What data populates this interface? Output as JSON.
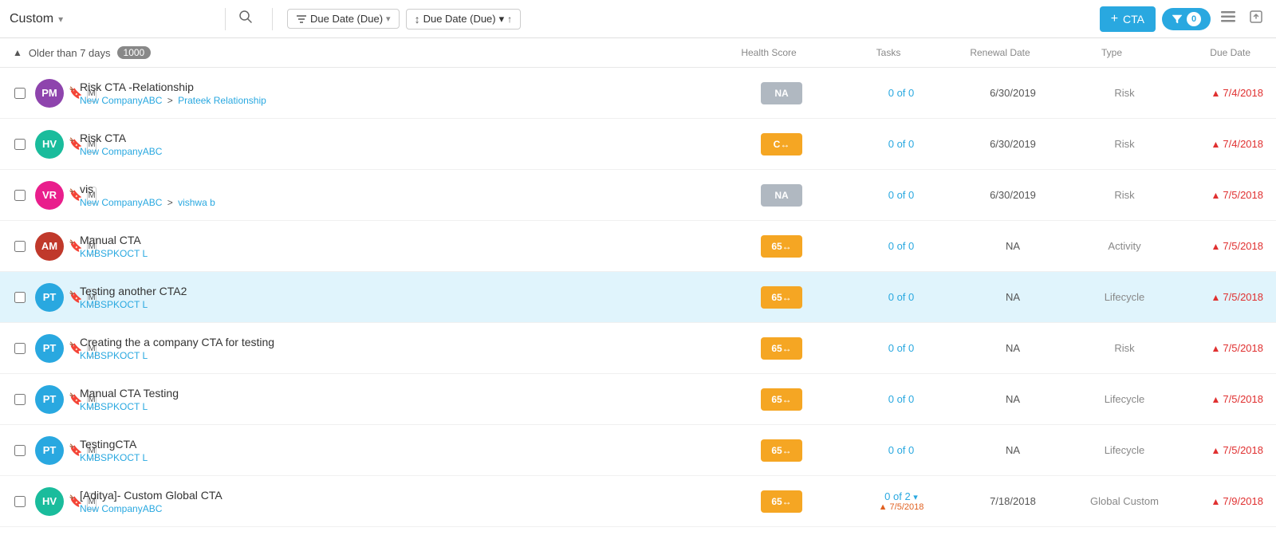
{
  "topbar": {
    "dropdown_label": "Custom",
    "filter1_label": "Due Date (Due)",
    "filter2_label": "Due Date (Due)",
    "cta_button": "+ CTA",
    "filter_count": "0",
    "icons": [
      "search",
      "filter",
      "export",
      "expand"
    ]
  },
  "group": {
    "label": "Older than 7 days",
    "count": "1000"
  },
  "columns": {
    "health": "Health Score",
    "tasks": "Tasks",
    "renewal": "Renewal Date",
    "type": "Type",
    "due": "Due Date"
  },
  "rows": [
    {
      "id": 1,
      "initials": "PM",
      "avatar_color": "#8e44ad",
      "title": "Risk CTA -Relationship",
      "company": "New CompanyABC",
      "sub": "Prateek Relationship",
      "has_sub": true,
      "health": "NA",
      "health_type": "na",
      "tasks": "0 of 0",
      "tasks_link": true,
      "renewal": "6/30/2019",
      "type": "Risk",
      "due": "7/4/2018",
      "due_overdue": true,
      "highlighted": false
    },
    {
      "id": 2,
      "initials": "HV",
      "avatar_color": "#1abc9c",
      "title": "Risk CTA",
      "company": "New CompanyABC",
      "sub": "",
      "has_sub": false,
      "health": "C↔",
      "health_type": "orange",
      "tasks": "0 of 0",
      "tasks_link": true,
      "renewal": "6/30/2019",
      "type": "Risk",
      "due": "7/4/2018",
      "due_overdue": true,
      "highlighted": false
    },
    {
      "id": 3,
      "initials": "VR",
      "avatar_color": "#e91e8c",
      "title": "vis",
      "company": "New CompanyABC",
      "sub": "vishwa b",
      "has_sub": true,
      "health": "NA",
      "health_type": "na",
      "tasks": "0 of 0",
      "tasks_link": true,
      "renewal": "6/30/2019",
      "type": "Risk",
      "due": "7/5/2018",
      "due_overdue": true,
      "highlighted": false
    },
    {
      "id": 4,
      "initials": "AM",
      "avatar_color": "#c0392b",
      "title": "Manual CTA",
      "company": "KMBSPKOCT L",
      "sub": "",
      "has_sub": false,
      "health": "65↔",
      "health_type": "orange",
      "tasks": "0 of 0",
      "tasks_link": true,
      "renewal": "NA",
      "type": "Activity",
      "due": "7/5/2018",
      "due_overdue": true,
      "highlighted": false
    },
    {
      "id": 5,
      "initials": "PT",
      "avatar_color": "#29a8e0",
      "title": "Testing another CTA2",
      "company": "KMBSPKOCT L",
      "sub": "",
      "has_sub": false,
      "health": "65↔",
      "health_type": "orange",
      "tasks": "0 of 0",
      "tasks_link": true,
      "renewal": "NA",
      "type": "Lifecycle",
      "due": "7/5/2018",
      "due_overdue": true,
      "highlighted": true
    },
    {
      "id": 6,
      "initials": "PT",
      "avatar_color": "#29a8e0",
      "title": "Creating the a company CTA for testing",
      "company": "KMBSPKOCT L",
      "sub": "",
      "has_sub": false,
      "health": "65↔",
      "health_type": "orange",
      "tasks": "0 of 0",
      "tasks_link": true,
      "renewal": "NA",
      "type": "Risk",
      "due": "7/5/2018",
      "due_overdue": true,
      "highlighted": false
    },
    {
      "id": 7,
      "initials": "PT",
      "avatar_color": "#29a8e0",
      "title": "Manual CTA Testing",
      "company": "KMBSPKOCT L",
      "sub": "",
      "has_sub": false,
      "health": "65↔",
      "health_type": "orange",
      "tasks": "0 of 0",
      "tasks_link": true,
      "renewal": "NA",
      "type": "Lifecycle",
      "due": "7/5/2018",
      "due_overdue": true,
      "highlighted": false
    },
    {
      "id": 8,
      "initials": "PT",
      "avatar_color": "#29a8e0",
      "title": "TestingCTA",
      "company": "KMBSPKOCT L",
      "sub": "",
      "has_sub": false,
      "health": "65↔",
      "health_type": "orange",
      "tasks": "0 of 0",
      "tasks_link": true,
      "renewal": "NA",
      "type": "Lifecycle",
      "due": "7/5/2018",
      "due_overdue": true,
      "highlighted": false
    },
    {
      "id": 9,
      "initials": "HV",
      "avatar_color": "#1abc9c",
      "title": "[Aditya]- Custom Global CTA",
      "company": "New CompanyABC",
      "sub": "",
      "has_sub": false,
      "health": "65↔",
      "health_type": "orange",
      "tasks": "0 of 2",
      "tasks_dropdown": true,
      "tasks_sub": "▲ 7/5/2018",
      "tasks_link": true,
      "renewal": "7/18/2018",
      "type": "Global Custom",
      "due": "7/9/2018",
      "due_overdue": true,
      "highlighted": false
    }
  ]
}
